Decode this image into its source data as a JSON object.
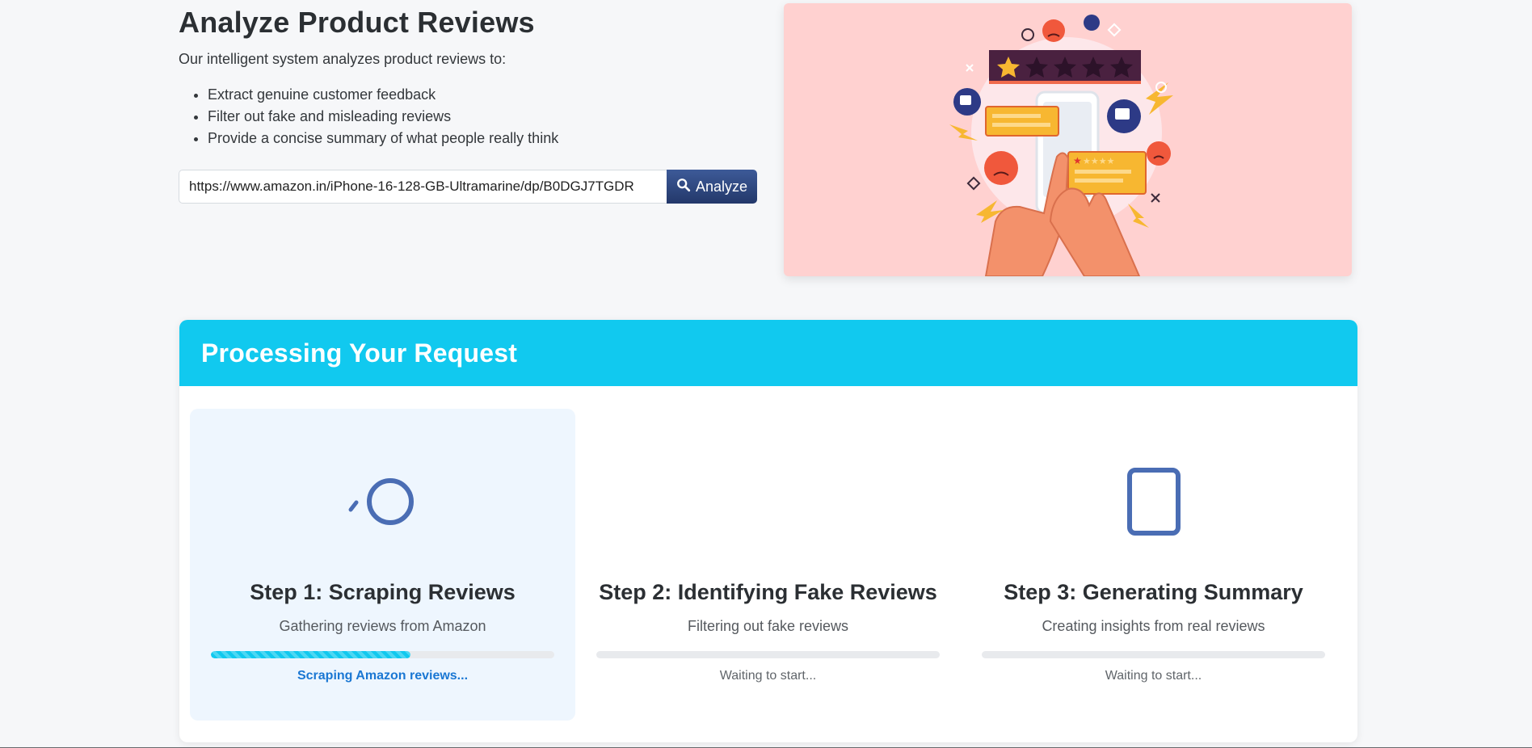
{
  "hero": {
    "title": "Analyze Product Reviews",
    "subtitle": "Our intelligent system analyzes product reviews to:",
    "features": [
      "Extract genuine customer feedback",
      "Filter out fake and misleading reviews",
      "Provide a concise summary of what people really think"
    ],
    "url_input_value": "https://www.amazon.in/iPhone-16-128-GB-Ultramarine/dp/B0DGJ7TGDR",
    "analyze_label": "Analyze",
    "analyze_icon": "search-icon",
    "illustration_icon": "reviews-illustration"
  },
  "process": {
    "title": "Processing Your Request",
    "steps": [
      {
        "title": "Step 1: Scraping Reviews",
        "description": "Gathering reviews from Amazon",
        "status": "Scraping Amazon reviews...",
        "progress": 0.58,
        "icon": "spinner-icon",
        "active": true
      },
      {
        "title": "Step 2: Identifying Fake Reviews",
        "description": "Filtering out fake reviews",
        "status": "Waiting to start...",
        "progress": 0,
        "icon": "none",
        "active": false
      },
      {
        "title": "Step 3: Generating Summary",
        "description": "Creating insights from real reviews",
        "status": "Waiting to start...",
        "progress": 0,
        "icon": "document-icon",
        "active": false
      }
    ]
  },
  "colors": {
    "accent": "#11c9ef",
    "button": "#23386a",
    "active_step_bg": "#eef6fe",
    "status_running": "#1a77d3",
    "illustration_bg": "#ffd1d0"
  }
}
